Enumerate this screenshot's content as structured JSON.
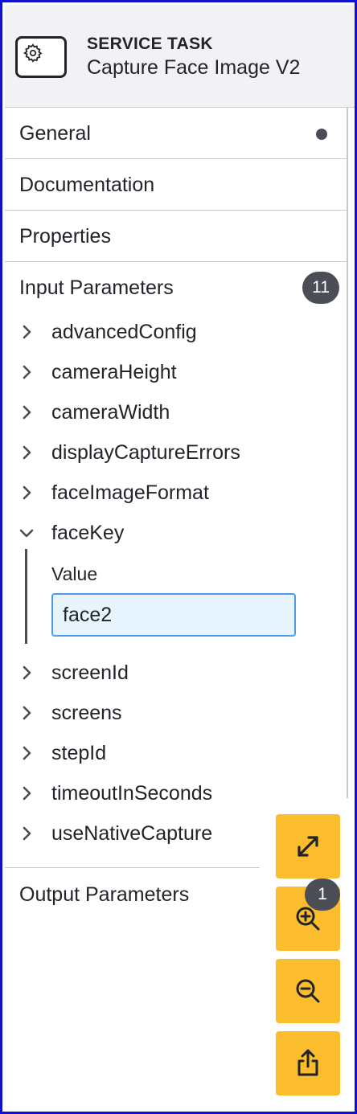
{
  "header": {
    "type_label": "SERVICE TASK",
    "task_name": "Capture Face Image V2",
    "icon": "gear-icon"
  },
  "groups": {
    "general": "General",
    "documentation": "Documentation",
    "properties": "Properties",
    "input_parameters": "Input Parameters",
    "output_parameters": "Output Parameters"
  },
  "input_count": "11",
  "params": [
    "advancedConfig",
    "cameraHeight",
    "cameraWidth",
    "displayCaptureErrors",
    "faceImageFormat",
    "faceKey",
    "screenId",
    "screens",
    "stepId",
    "timeoutInSeconds",
    "useNativeCapture"
  ],
  "expanded_param": {
    "value_label": "Value",
    "value": "face2"
  },
  "fab": {
    "zoom_badge": "1",
    "icons": [
      "expand-icon",
      "zoom-in-icon",
      "zoom-out-icon",
      "share-icon"
    ]
  },
  "colors": {
    "accent": "#fbbd2e",
    "badge": "#4b4d57",
    "input_border": "#4d9ae6",
    "frame": "#1010d0"
  }
}
